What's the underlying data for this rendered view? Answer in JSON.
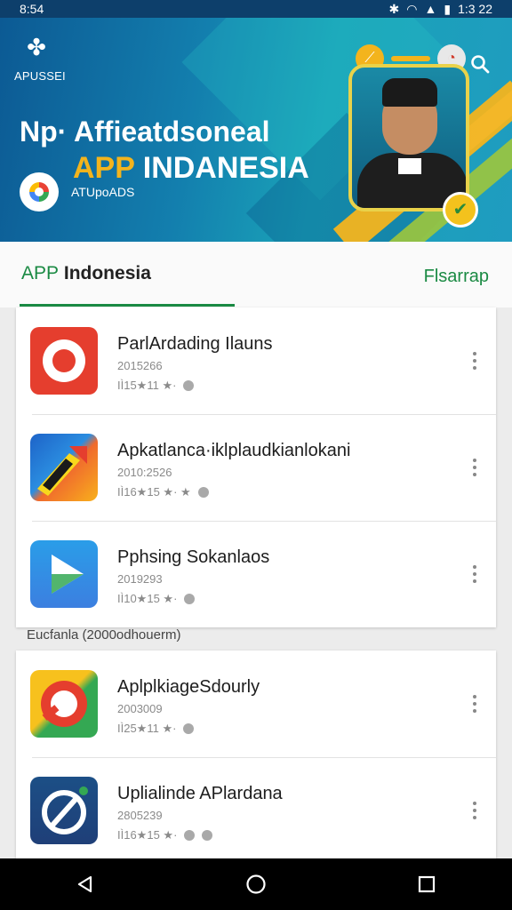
{
  "status_bar": {
    "time": "8:54",
    "clock": "1:3 22"
  },
  "hero": {
    "brand": "APUSSEI",
    "title_line1": "Np· Affieatdsoneal",
    "title_app": "APP",
    "title_rest": " INDANESIA",
    "badge_label": "ATUpoADS"
  },
  "tabs": {
    "active_app": "APP",
    "active_rest": " Indonesia",
    "other": "Flsarrap"
  },
  "section_label": "Eucfanla (2000odhouerm)",
  "group1": [
    {
      "name": "ParlArdading Ilauns",
      "date": "2015266",
      "meta": "IÌ15★11 ★·"
    },
    {
      "name": "Apkatlanca·iklplaudkianlokani",
      "date": "2010:2526",
      "meta": "IÌ16★15 ★· ★"
    },
    {
      "name": "Pphsing Sokanlaos",
      "date": "2019293",
      "meta": "IÌ10★15 ★·"
    }
  ],
  "group2": [
    {
      "name": "AplplkiageSdourly",
      "date": "2003009",
      "meta": "IÌ25★11 ★·"
    },
    {
      "name": "Uplialinde APlardana",
      "date": "2805239",
      "meta": "IÌ16★15 ★·"
    }
  ],
  "colors": {
    "accent_green": "#1a8a43",
    "hero_blue": "#137fae",
    "hero_yellow": "#f3b41d"
  }
}
